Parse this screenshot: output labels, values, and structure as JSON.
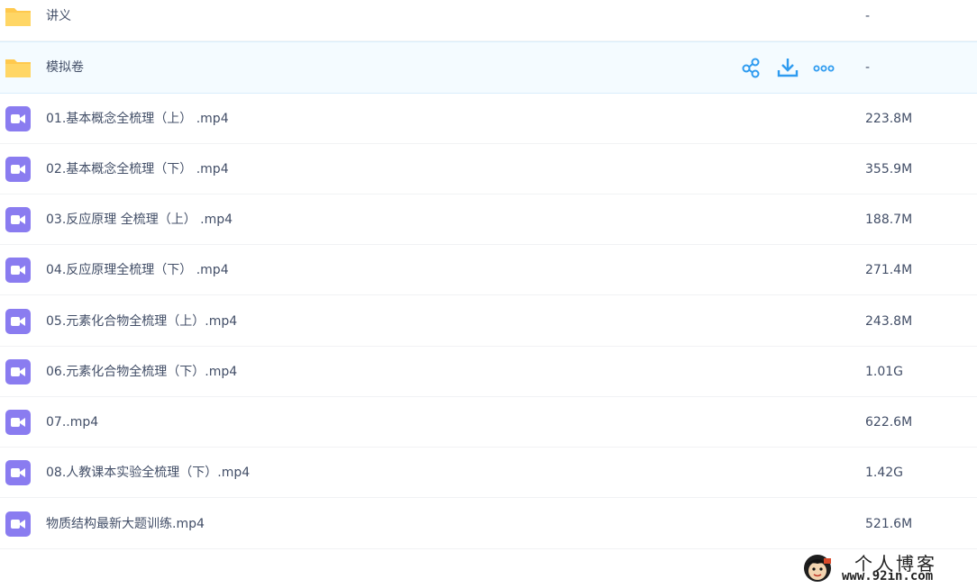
{
  "files": [
    {
      "name": "讲义",
      "size": "-",
      "type": "folder"
    },
    {
      "name": "模拟卷",
      "size": "-",
      "type": "folder"
    },
    {
      "name": "01.基本概念全梳理（上） .mp4",
      "size": "223.8M",
      "type": "video"
    },
    {
      "name": "02.基本概念全梳理（下） .mp4",
      "size": "355.9M",
      "type": "video"
    },
    {
      "name": "03.反应原理 全梳理（上） .mp4",
      "size": "188.7M",
      "type": "video"
    },
    {
      "name": "04.反应原理全梳理（下） .mp4",
      "size": "271.4M",
      "type": "video"
    },
    {
      "name": "05.元素化合物全梳理（上）.mp4",
      "size": "243.8M",
      "type": "video"
    },
    {
      "name": "06.元素化合物全梳理（下）.mp4",
      "size": "1.01G",
      "type": "video"
    },
    {
      "name": "07..mp4",
      "size": "622.6M",
      "type": "video"
    },
    {
      "name": "08.人教课本实验全梳理（下）.mp4",
      "size": "1.42G",
      "type": "video"
    },
    {
      "name": "物质结构最新大题训练.mp4",
      "size": "521.6M",
      "type": "video"
    }
  ],
  "row_actions": [
    "share-icon",
    "download-icon",
    "more-icon"
  ],
  "colors": {
    "folder": "#ffc94d",
    "video": "#8a7cf0",
    "action": "#2e9bf0",
    "hover_row": "#f4fbff"
  },
  "watermark": {
    "title": "个人博客",
    "url": "www.92in.com"
  }
}
